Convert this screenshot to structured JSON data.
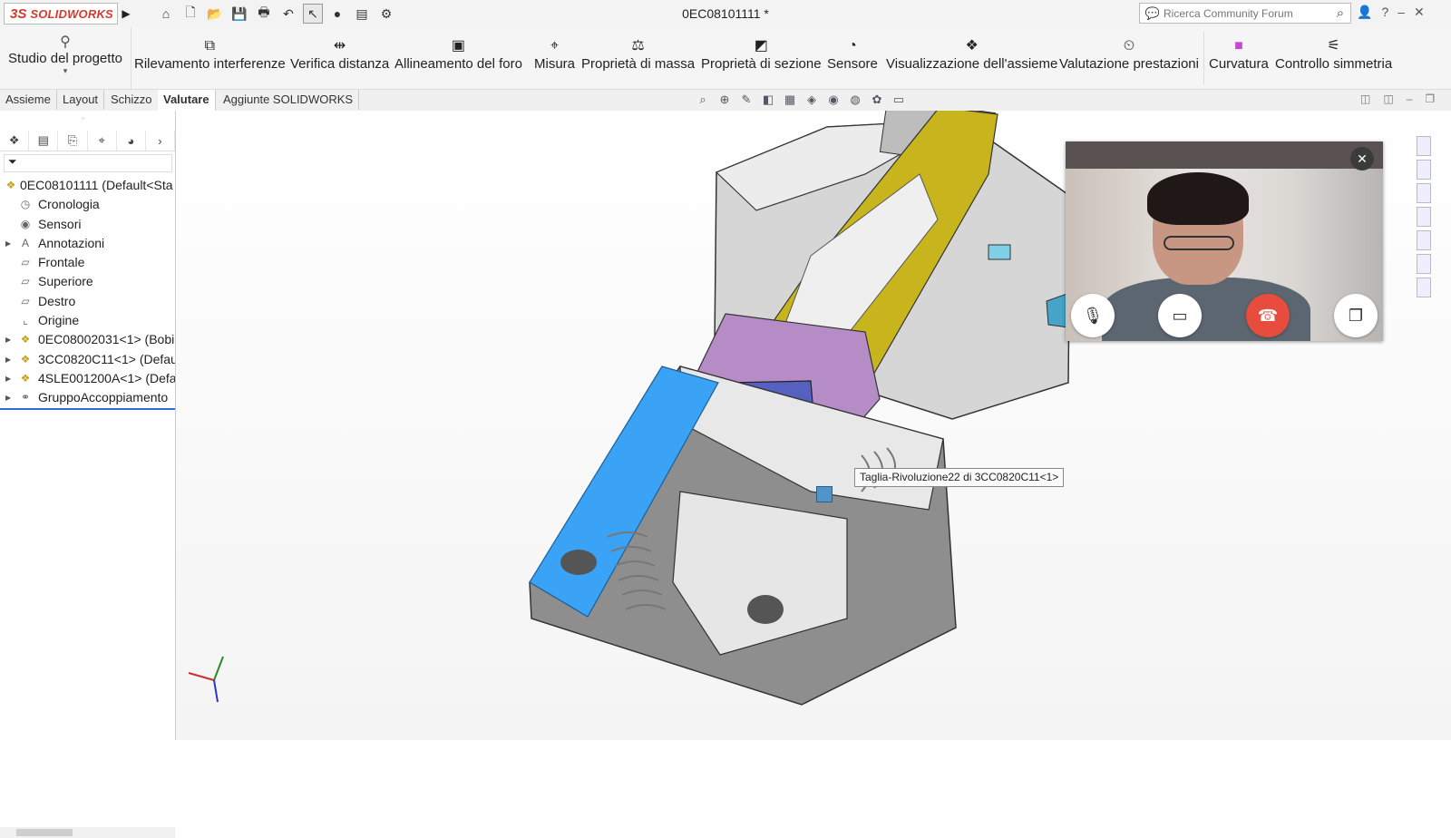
{
  "app": {
    "logo_ds": "3S",
    "logo_name": "SOLIDWORKS",
    "document_title": "0EC08101111 *"
  },
  "search": {
    "placeholder": "Ricerca Community Forum"
  },
  "ribbon": {
    "studio_label": "Studio del progetto",
    "buttons": [
      {
        "label": "Rilevamento interferenze",
        "icon": "interference-icon"
      },
      {
        "label": "Verifica distanza",
        "icon": "clearance-icon"
      },
      {
        "label": "Allineamento del foro",
        "icon": "hole-alignment-icon"
      },
      {
        "label": "Misura",
        "icon": "measure-icon"
      },
      {
        "label": "Proprietà di massa",
        "icon": "mass-properties-icon"
      },
      {
        "label": "Proprietà di sezione",
        "icon": "section-properties-icon"
      },
      {
        "label": "Sensore",
        "icon": "sensor-icon"
      },
      {
        "label": "Visualizzazione dell'assieme",
        "icon": "assembly-visualization-icon"
      },
      {
        "label": "Valutazione prestazioni",
        "icon": "performance-evaluation-icon"
      },
      {
        "label": "Curvatura",
        "icon": "curvature-icon"
      },
      {
        "label": "Controllo simmetria",
        "icon": "symmetry-check-icon"
      }
    ]
  },
  "tabs": [
    {
      "label": "Assieme",
      "active": false
    },
    {
      "label": "Layout",
      "active": false
    },
    {
      "label": "Schizzo",
      "active": false
    },
    {
      "label": "Valutare",
      "active": true
    },
    {
      "label": "Aggiunte SOLIDWORKS",
      "active": false
    }
  ],
  "tree": {
    "root": "0EC08101111  (Default<Sta",
    "items": [
      {
        "label": "Cronologia",
        "icon": "history-icon",
        "expandable": false
      },
      {
        "label": "Sensori",
        "icon": "sensors-icon",
        "expandable": false
      },
      {
        "label": "Annotazioni",
        "icon": "annotations-icon",
        "expandable": true
      },
      {
        "label": "Frontale",
        "icon": "plane-icon",
        "expandable": false
      },
      {
        "label": "Superiore",
        "icon": "plane-icon",
        "expandable": false
      },
      {
        "label": "Destro",
        "icon": "plane-icon",
        "expandable": false
      },
      {
        "label": "Origine",
        "icon": "origin-icon",
        "expandable": false
      },
      {
        "label": "0EC08002031<1>  (Bobi",
        "icon": "assembly-icon",
        "expandable": true
      },
      {
        "label": "3CC0820C11<1>  (Defau",
        "icon": "assembly-icon",
        "expandable": true
      },
      {
        "label": "4SLE001200A<1>  (Defa",
        "icon": "assembly-icon",
        "expandable": true
      },
      {
        "label": "GruppoAccoppiamento",
        "icon": "mates-icon",
        "expandable": true
      }
    ]
  },
  "viewport": {
    "tooltip": "Taglia-Rivoluzione22 di 3CC0820C11<1>"
  },
  "colors": {
    "accent_blue": "#3aa3f5",
    "part_yellow": "#c8b51e",
    "part_purple": "#b58cc5",
    "part_indigo": "#5560c0",
    "end_call_red": "#e74c3c"
  }
}
